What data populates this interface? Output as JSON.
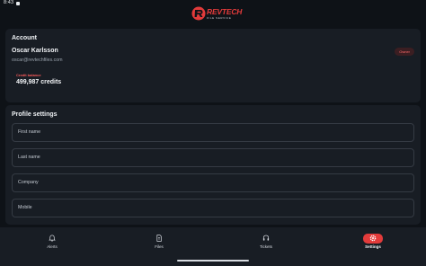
{
  "status_bar": {
    "time": "8:43"
  },
  "logo": {
    "brand": "REVTECH",
    "tagline": "FILE SERVICE"
  },
  "account": {
    "title": "Account",
    "name": "Oscar Karlsson",
    "email": "oscar@revtechfiles.com",
    "role_badge": "Owner",
    "credit_label": "Credit balance",
    "credit_value": "499,987 credits"
  },
  "profile": {
    "title": "Profile settings",
    "fields": [
      {
        "label": "First name"
      },
      {
        "label": "Last name"
      },
      {
        "label": "Company"
      },
      {
        "label": "Mobile"
      }
    ]
  },
  "nav": {
    "items": [
      {
        "label": "Alerts",
        "icon": "bell-icon"
      },
      {
        "label": "Files",
        "icon": "file-icon"
      },
      {
        "label": "Tickets",
        "icon": "headset-icon"
      },
      {
        "label": "Settings",
        "icon": "settings-icon",
        "active": true
      }
    ]
  },
  "colors": {
    "accent": "#e23b3b",
    "background": "#0e1217",
    "card": "#181d24"
  }
}
